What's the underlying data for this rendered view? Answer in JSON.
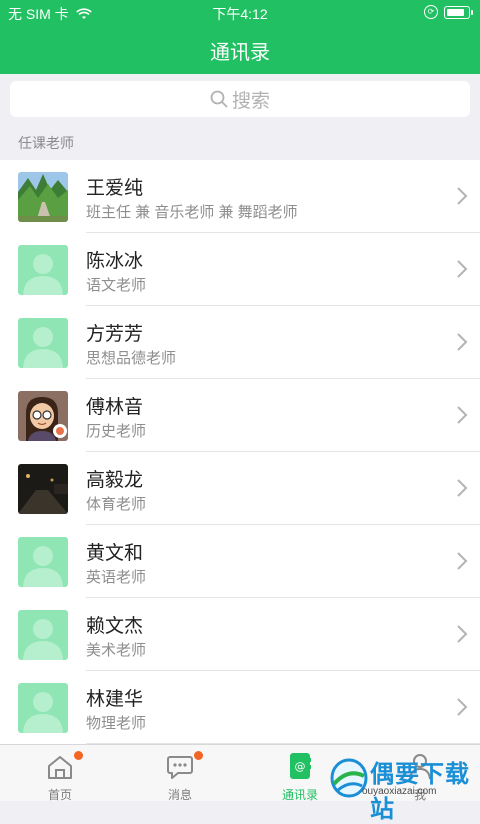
{
  "status_bar": {
    "carrier": "无 SIM 卡",
    "time": "下午4:12"
  },
  "header": {
    "title": "通讯录"
  },
  "search": {
    "placeholder": "搜索"
  },
  "section": {
    "title": "任课老师"
  },
  "contacts": [
    {
      "name": "王爱纯",
      "role": "班主任 兼 音乐老师 兼 舞蹈老师",
      "avatar": "photo-trees"
    },
    {
      "name": "陈冰冰",
      "role": "语文老师",
      "avatar": "default-person"
    },
    {
      "name": "方芳芳",
      "role": "思想品德老师",
      "avatar": "default-person"
    },
    {
      "name": "傅林音",
      "role": "历史老师",
      "avatar": "photo-cartoon-girl"
    },
    {
      "name": "高毅龙",
      "role": "体育老师",
      "avatar": "photo-night-road"
    },
    {
      "name": "黄文和",
      "role": "英语老师",
      "avatar": "default-person"
    },
    {
      "name": "赖文杰",
      "role": "美术老师",
      "avatar": "default-person"
    },
    {
      "name": "林建华",
      "role": "物理老师",
      "avatar": "default-person"
    }
  ],
  "tabs": [
    {
      "label": "首页",
      "icon": "home-icon",
      "badge": true
    },
    {
      "label": "消息",
      "icon": "message-icon",
      "badge": true
    },
    {
      "label": "通讯录",
      "icon": "contacts-icon",
      "active": true
    },
    {
      "label": "我",
      "icon": "person-icon"
    }
  ],
  "watermark": {
    "text": "偶要下载站",
    "url": "ouyaoxiazai.com"
  },
  "colors": {
    "primary": "#21c063",
    "badge": "#f26522",
    "avatar_default": "#8fe5b3"
  }
}
